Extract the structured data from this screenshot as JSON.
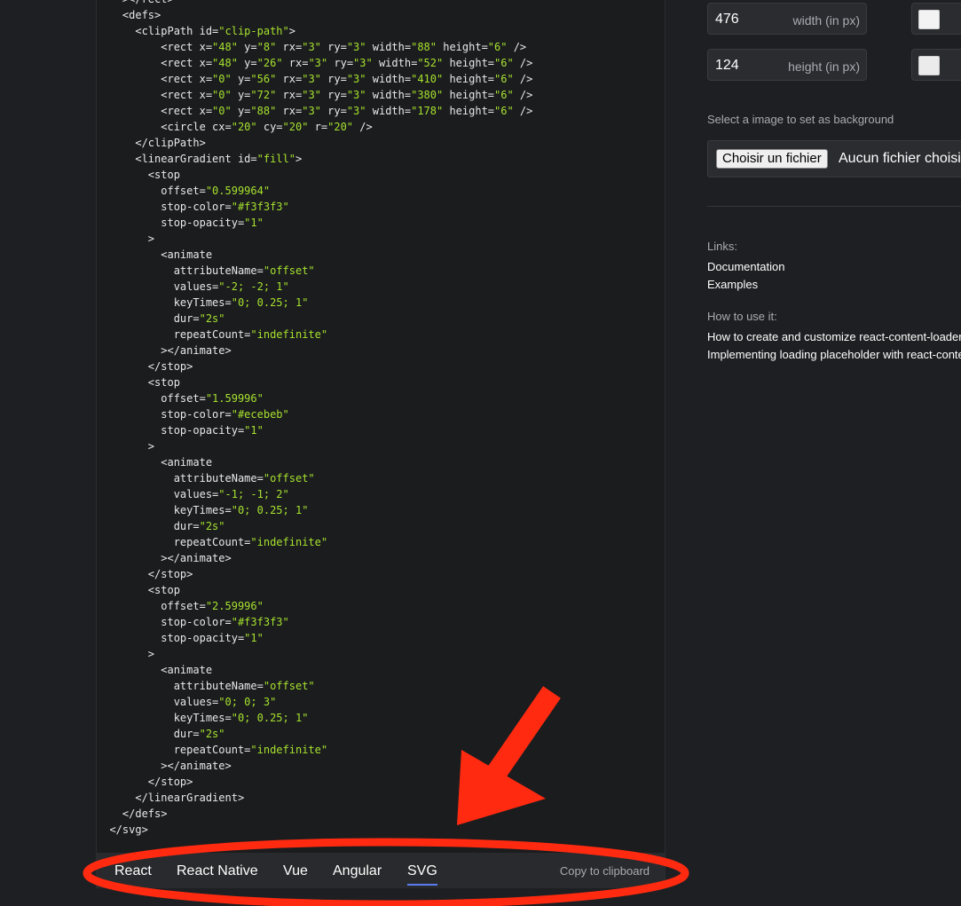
{
  "code": {
    "language": "svg",
    "lines": [
      [
        {
          "t": "    ></rect>",
          "c": "p"
        }
      ],
      [
        {
          "t": "    <defs>",
          "c": "p"
        }
      ],
      [
        {
          "t": "      <clipPath id=",
          "c": "p"
        },
        {
          "t": "\"clip-path\"",
          "c": "s"
        },
        {
          "t": ">",
          "c": "p"
        }
      ],
      [
        {
          "t": "          <rect x=",
          "c": "p"
        },
        {
          "t": "\"48\"",
          "c": "s"
        },
        {
          "t": " y=",
          "c": "p"
        },
        {
          "t": "\"8\"",
          "c": "s"
        },
        {
          "t": " rx=",
          "c": "p"
        },
        {
          "t": "\"3\"",
          "c": "s"
        },
        {
          "t": " ry=",
          "c": "p"
        },
        {
          "t": "\"3\"",
          "c": "s"
        },
        {
          "t": " width=",
          "c": "p"
        },
        {
          "t": "\"88\"",
          "c": "s"
        },
        {
          "t": " height=",
          "c": "p"
        },
        {
          "t": "\"6\"",
          "c": "s"
        },
        {
          "t": " />",
          "c": "p"
        }
      ],
      [
        {
          "t": "          <rect x=",
          "c": "p"
        },
        {
          "t": "\"48\"",
          "c": "s"
        },
        {
          "t": " y=",
          "c": "p"
        },
        {
          "t": "\"26\"",
          "c": "s"
        },
        {
          "t": " rx=",
          "c": "p"
        },
        {
          "t": "\"3\"",
          "c": "s"
        },
        {
          "t": " ry=",
          "c": "p"
        },
        {
          "t": "\"3\"",
          "c": "s"
        },
        {
          "t": " width=",
          "c": "p"
        },
        {
          "t": "\"52\"",
          "c": "s"
        },
        {
          "t": " height=",
          "c": "p"
        },
        {
          "t": "\"6\"",
          "c": "s"
        },
        {
          "t": " />",
          "c": "p"
        }
      ],
      [
        {
          "t": "          <rect x=",
          "c": "p"
        },
        {
          "t": "\"0\"",
          "c": "s"
        },
        {
          "t": " y=",
          "c": "p"
        },
        {
          "t": "\"56\"",
          "c": "s"
        },
        {
          "t": " rx=",
          "c": "p"
        },
        {
          "t": "\"3\"",
          "c": "s"
        },
        {
          "t": " ry=",
          "c": "p"
        },
        {
          "t": "\"3\"",
          "c": "s"
        },
        {
          "t": " width=",
          "c": "p"
        },
        {
          "t": "\"410\"",
          "c": "s"
        },
        {
          "t": " height=",
          "c": "p"
        },
        {
          "t": "\"6\"",
          "c": "s"
        },
        {
          "t": " />",
          "c": "p"
        }
      ],
      [
        {
          "t": "          <rect x=",
          "c": "p"
        },
        {
          "t": "\"0\"",
          "c": "s"
        },
        {
          "t": " y=",
          "c": "p"
        },
        {
          "t": "\"72\"",
          "c": "s"
        },
        {
          "t": " rx=",
          "c": "p"
        },
        {
          "t": "\"3\"",
          "c": "s"
        },
        {
          "t": " ry=",
          "c": "p"
        },
        {
          "t": "\"3\"",
          "c": "s"
        },
        {
          "t": " width=",
          "c": "p"
        },
        {
          "t": "\"380\"",
          "c": "s"
        },
        {
          "t": " height=",
          "c": "p"
        },
        {
          "t": "\"6\"",
          "c": "s"
        },
        {
          "t": " />",
          "c": "p"
        }
      ],
      [
        {
          "t": "          <rect x=",
          "c": "p"
        },
        {
          "t": "\"0\"",
          "c": "s"
        },
        {
          "t": " y=",
          "c": "p"
        },
        {
          "t": "\"88\"",
          "c": "s"
        },
        {
          "t": " rx=",
          "c": "p"
        },
        {
          "t": "\"3\"",
          "c": "s"
        },
        {
          "t": " ry=",
          "c": "p"
        },
        {
          "t": "\"3\"",
          "c": "s"
        },
        {
          "t": " width=",
          "c": "p"
        },
        {
          "t": "\"178\"",
          "c": "s"
        },
        {
          "t": " height=",
          "c": "p"
        },
        {
          "t": "\"6\"",
          "c": "s"
        },
        {
          "t": " />",
          "c": "p"
        }
      ],
      [
        {
          "t": "          <circle cx=",
          "c": "p"
        },
        {
          "t": "\"20\"",
          "c": "s"
        },
        {
          "t": " cy=",
          "c": "p"
        },
        {
          "t": "\"20\"",
          "c": "s"
        },
        {
          "t": " r=",
          "c": "p"
        },
        {
          "t": "\"20\"",
          "c": "s"
        },
        {
          "t": " />",
          "c": "p"
        }
      ],
      [
        {
          "t": "      </clipPath>",
          "c": "p"
        }
      ],
      [
        {
          "t": "      <linearGradient id=",
          "c": "p"
        },
        {
          "t": "\"fill\"",
          "c": "s"
        },
        {
          "t": ">",
          "c": "p"
        }
      ],
      [
        {
          "t": "        <stop",
          "c": "p"
        }
      ],
      [
        {
          "t": "          offset=",
          "c": "p"
        },
        {
          "t": "\"0.599964\"",
          "c": "s"
        }
      ],
      [
        {
          "t": "          stop-color=",
          "c": "p"
        },
        {
          "t": "\"#f3f3f3\"",
          "c": "s"
        }
      ],
      [
        {
          "t": "          stop-opacity=",
          "c": "p"
        },
        {
          "t": "\"1\"",
          "c": "s"
        }
      ],
      [
        {
          "t": "        >",
          "c": "p"
        }
      ],
      [
        {
          "t": "          <animate",
          "c": "p"
        }
      ],
      [
        {
          "t": "            attributeName=",
          "c": "p"
        },
        {
          "t": "\"offset\"",
          "c": "s"
        }
      ],
      [
        {
          "t": "            values=",
          "c": "p"
        },
        {
          "t": "\"-2; -2; 1\"",
          "c": "s"
        }
      ],
      [
        {
          "t": "            keyTimes=",
          "c": "p"
        },
        {
          "t": "\"0; 0.25; 1\"",
          "c": "s"
        }
      ],
      [
        {
          "t": "            dur=",
          "c": "p"
        },
        {
          "t": "\"2s\"",
          "c": "s"
        }
      ],
      [
        {
          "t": "            repeatCount=",
          "c": "p"
        },
        {
          "t": "\"indefinite\"",
          "c": "s"
        }
      ],
      [
        {
          "t": "          ></animate>",
          "c": "p"
        }
      ],
      [
        {
          "t": "        </stop>",
          "c": "p"
        }
      ],
      [
        {
          "t": "        <stop",
          "c": "p"
        }
      ],
      [
        {
          "t": "          offset=",
          "c": "p"
        },
        {
          "t": "\"1.59996\"",
          "c": "s"
        }
      ],
      [
        {
          "t": "          stop-color=",
          "c": "p"
        },
        {
          "t": "\"#ecebeb\"",
          "c": "s"
        }
      ],
      [
        {
          "t": "          stop-opacity=",
          "c": "p"
        },
        {
          "t": "\"1\"",
          "c": "s"
        }
      ],
      [
        {
          "t": "        >",
          "c": "p"
        }
      ],
      [
        {
          "t": "          <animate",
          "c": "p"
        }
      ],
      [
        {
          "t": "            attributeName=",
          "c": "p"
        },
        {
          "t": "\"offset\"",
          "c": "s"
        }
      ],
      [
        {
          "t": "            values=",
          "c": "p"
        },
        {
          "t": "\"-1; -1; 2\"",
          "c": "s"
        }
      ],
      [
        {
          "t": "            keyTimes=",
          "c": "p"
        },
        {
          "t": "\"0; 0.25; 1\"",
          "c": "s"
        }
      ],
      [
        {
          "t": "            dur=",
          "c": "p"
        },
        {
          "t": "\"2s\"",
          "c": "s"
        }
      ],
      [
        {
          "t": "            repeatCount=",
          "c": "p"
        },
        {
          "t": "\"indefinite\"",
          "c": "s"
        }
      ],
      [
        {
          "t": "          ></animate>",
          "c": "p"
        }
      ],
      [
        {
          "t": "        </stop>",
          "c": "p"
        }
      ],
      [
        {
          "t": "        <stop",
          "c": "p"
        }
      ],
      [
        {
          "t": "          offset=",
          "c": "p"
        },
        {
          "t": "\"2.59996\"",
          "c": "s"
        }
      ],
      [
        {
          "t": "          stop-color=",
          "c": "p"
        },
        {
          "t": "\"#f3f3f3\"",
          "c": "s"
        }
      ],
      [
        {
          "t": "          stop-opacity=",
          "c": "p"
        },
        {
          "t": "\"1\"",
          "c": "s"
        }
      ],
      [
        {
          "t": "        >",
          "c": "p"
        }
      ],
      [
        {
          "t": "          <animate",
          "c": "p"
        }
      ],
      [
        {
          "t": "            attributeName=",
          "c": "p"
        },
        {
          "t": "\"offset\"",
          "c": "s"
        }
      ],
      [
        {
          "t": "            values=",
          "c": "p"
        },
        {
          "t": "\"0; 0; 3\"",
          "c": "s"
        }
      ],
      [
        {
          "t": "            keyTimes=",
          "c": "p"
        },
        {
          "t": "\"0; 0.25; 1\"",
          "c": "s"
        }
      ],
      [
        {
          "t": "            dur=",
          "c": "p"
        },
        {
          "t": "\"2s\"",
          "c": "s"
        }
      ],
      [
        {
          "t": "            repeatCount=",
          "c": "p"
        },
        {
          "t": "\"indefinite\"",
          "c": "s"
        }
      ],
      [
        {
          "t": "          ></animate>",
          "c": "p"
        }
      ],
      [
        {
          "t": "        </stop>",
          "c": "p"
        }
      ],
      [
        {
          "t": "      </linearGradient>",
          "c": "p"
        }
      ],
      [
        {
          "t": "    </defs>",
          "c": "p"
        }
      ],
      [
        {
          "t": "  </svg>",
          "c": "p"
        }
      ]
    ]
  },
  "tabs": {
    "items": [
      {
        "label": "React",
        "name": "tab-react",
        "active": false
      },
      {
        "label": "React Native",
        "name": "tab-react-native",
        "active": false
      },
      {
        "label": "Vue",
        "name": "tab-vue",
        "active": false
      },
      {
        "label": "Angular",
        "name": "tab-angular",
        "active": false
      },
      {
        "label": "SVG",
        "name": "tab-svg",
        "active": true
      }
    ],
    "copy_label": "Copy to clipboard"
  },
  "settings": {
    "width": {
      "value": "476",
      "label": "width (in px)"
    },
    "height": {
      "value": "124",
      "label": "height (in px)"
    },
    "background_color": "#f3f3f3",
    "foreground_color": "#ecebeb",
    "background_image_label": "Select a image to set as background",
    "file_button": "Choisir un fichier",
    "file_status": "Aucun fichier choisi"
  },
  "links": {
    "heading": "Links:",
    "items": [
      "Documentation",
      "Examples"
    ]
  },
  "how_to": {
    "heading": "How to use it:",
    "items": [
      "How to create and customize react-content-loader",
      "Implementing loading placeholder with react-content-loader"
    ]
  },
  "colors": {
    "accent": "#5b7cf0",
    "string": "#a6e22e",
    "annotation": "#ff2a10"
  }
}
